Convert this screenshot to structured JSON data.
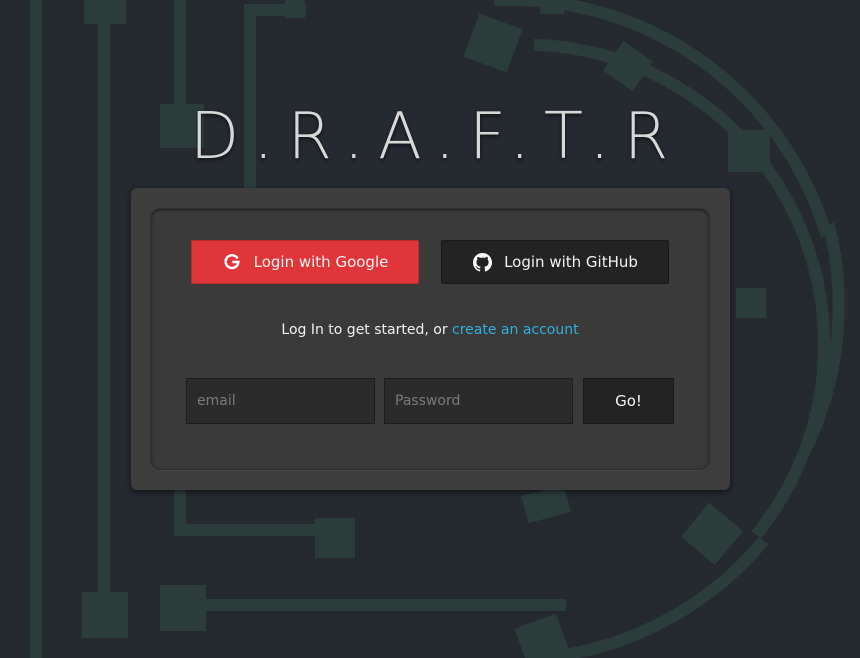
{
  "app": {
    "logo_text": "D.R.A.F.T.R"
  },
  "login": {
    "google_label": "Login with Google",
    "github_label": "Login with GitHub",
    "prompt_text": "Log In to get started, or ",
    "create_account_link": "create an account",
    "email_placeholder": "email",
    "password_placeholder": "Password",
    "go_label": "Go!"
  },
  "icons": {
    "google": "google-icon",
    "github": "github-icon"
  },
  "colors": {
    "background": "#252930",
    "circuit_lines": "#2b3d3a",
    "google_button": "#e0363a",
    "github_button": "#232323",
    "link": "#2fb0de",
    "card": "#3d3d3d"
  }
}
